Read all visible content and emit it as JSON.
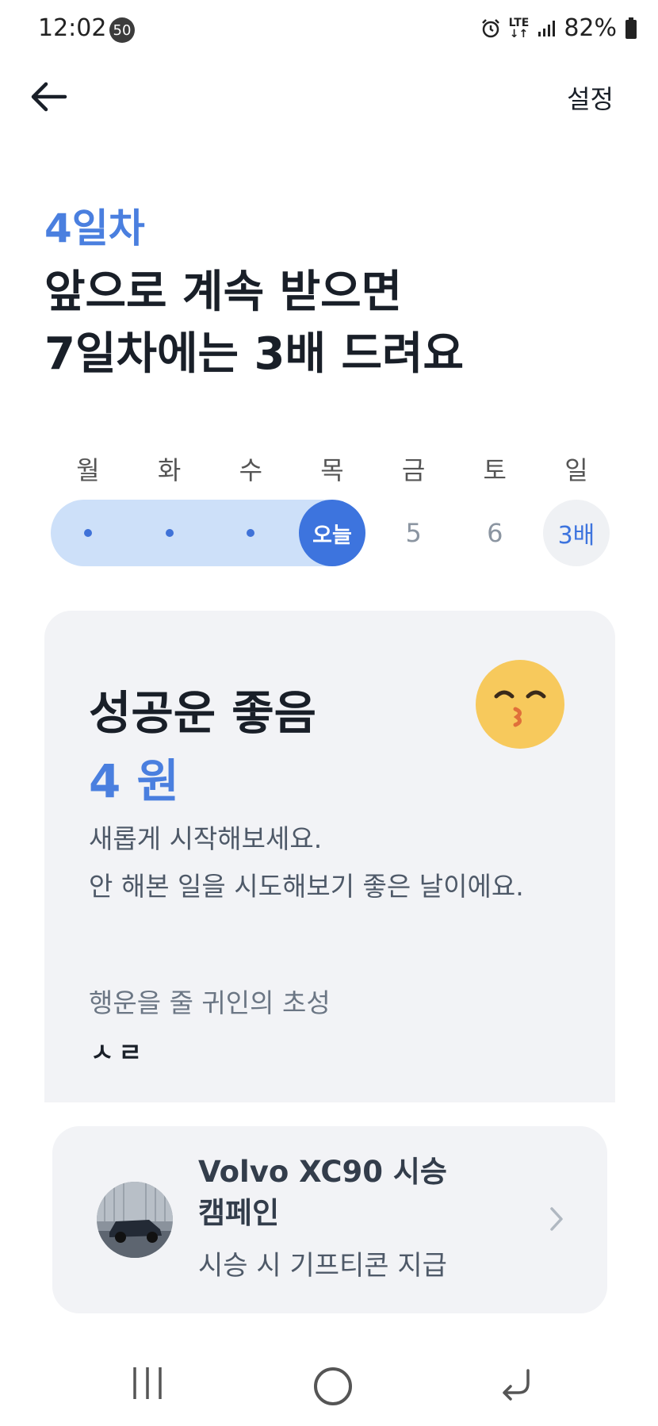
{
  "status_bar": {
    "time": "12:02",
    "notification_count": "50",
    "network": "LTE",
    "battery": "82%"
  },
  "nav": {
    "back_icon": "arrow-left-icon",
    "settings_label": "설정"
  },
  "streak": {
    "day_label": "4일차",
    "headline_line1": "앞으로 계속 받으면",
    "headline_line2": "7일차에는 3배 드려요",
    "weekdays": [
      "월",
      "화",
      "수",
      "목",
      "금",
      "토",
      "일"
    ],
    "today_label": "오늘",
    "day5": "5",
    "day6": "6",
    "bonus_label": "3배",
    "completed_days": 3
  },
  "fortune": {
    "title": "성공운 좋음",
    "amount": "4 원",
    "desc_line1": "새롭게 시작해보세요.",
    "desc_line2": "안 해본 일을 시도해보기 좋은 날이에요.",
    "helper_label": "행운을 줄 귀인의 초성",
    "helper_value": "ㅅㄹ",
    "emoji_icon": "kissing-face-icon"
  },
  "promo": {
    "title_line1": "Volvo XC90 시승",
    "title_line2": "캠페인",
    "subtitle": "시승 시 기프티콘 지급",
    "thumb_icon": "car-photo-icon",
    "chevron_icon": "chevron-right-icon"
  },
  "colors": {
    "accent": "#4a7fdf",
    "track": "#cde0f9",
    "card_bg": "#f2f3f6"
  }
}
